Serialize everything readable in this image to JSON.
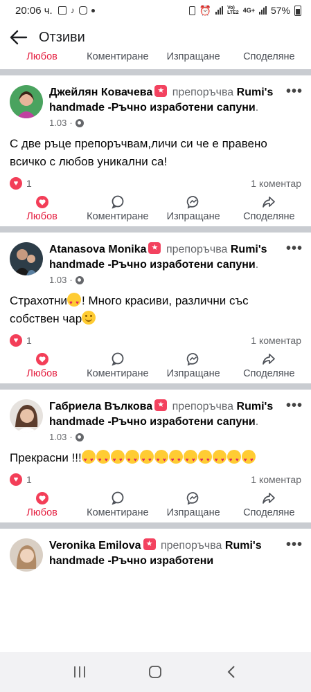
{
  "status_bar": {
    "time": "20:06 ч.",
    "battery": "57%",
    "network_top": "Vo)",
    "network_bottom": "LTE2",
    "network_type": "4G+"
  },
  "header": {
    "title": "Отзиви",
    "back_icon": "arrow-left-icon"
  },
  "actions": {
    "like": "Любов",
    "comment": "Коментиране",
    "send": "Изпращане",
    "share": "Споделяне"
  },
  "reviews": [
    {
      "author": "Джейлян Ковачева",
      "verb": "препоръчва",
      "page": "Rumi's handmade -Ръчно изработени сапуни",
      "date": "1.03",
      "text": "С две ръце препоръчвам,личи си че е правено всичко с любов уникални са!",
      "reactions": "1",
      "comments": "1 коментар"
    },
    {
      "author": "Atanasova Monika",
      "verb": "препоръчва",
      "page": "Rumi's handmade -Ръчно изработени сапуни",
      "date": "1.03",
      "text_part1": "Страхотни",
      "text_part2": "! Много красиви, различни със собствен чар",
      "reactions": "1",
      "comments": "1 коментар"
    },
    {
      "author": "Габриела Вълкова",
      "verb": "препоръчва",
      "page": "Rumi's handmade -Ръчно изработени сапуни",
      "date": "1.03",
      "text": "Прекрасни !!!",
      "heart_eyes_count": 12,
      "reactions": "1",
      "comments": "1 коментар"
    },
    {
      "author": "Veronika Emilova",
      "verb": "препоръчва",
      "page": "Rumi's handmade -Ръчно изработени"
    }
  ],
  "colors": {
    "love_red": "#e41e3f",
    "reaction_heart": "#f33e58",
    "badge_pink": "#f3425f",
    "muted_text": "#65676b",
    "divider": "#c9ccd1"
  }
}
